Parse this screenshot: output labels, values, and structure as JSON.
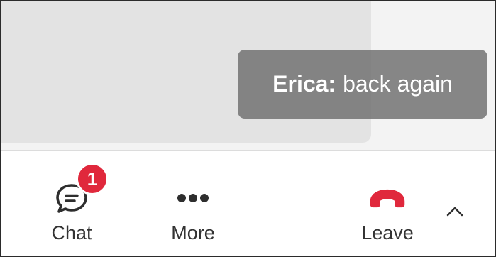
{
  "notification": {
    "sender": "Erica:",
    "message": "back again"
  },
  "toolbar": {
    "chat": {
      "label": "Chat",
      "icon": "chat-bubble-icon",
      "unread_count": "1"
    },
    "more": {
      "label": "More",
      "icon": "more-dots-icon"
    },
    "leave": {
      "label": "Leave",
      "icon": "hang-up-phone-icon"
    },
    "expand": {
      "icon": "chevron-up-icon"
    }
  },
  "colors": {
    "badge": "#e0283c",
    "leave": "#e0283c",
    "toast_bg": "#6e6e6e",
    "stage_bg": "#f3f3f3",
    "tile_bg": "#e3e3e3"
  }
}
